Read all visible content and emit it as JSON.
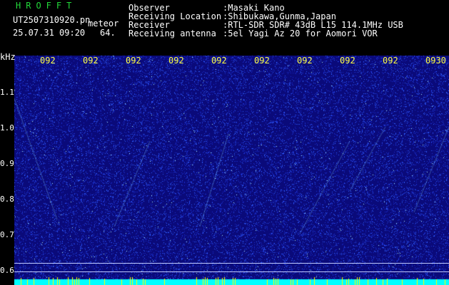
{
  "header": {
    "brand": "HROFFT",
    "filename": "UT2507310920.pn",
    "mode": "meteor",
    "datetime": "25.07.31 09:20",
    "count": "64.",
    "info": [
      {
        "label": "Observer",
        "value": ":Masaki Kano"
      },
      {
        "label": "Receiving Location",
        "value": ":Shibukawa,Gunma,Japan"
      },
      {
        "label": "Receiver",
        "value": ":RTL-SDR SDR# 43dB L15 114.1MHz USB"
      },
      {
        "label": "Receiving antenna",
        "value": ":5el Yagi Az 20 for Aomori VOR"
      }
    ]
  },
  "spectrogram": {
    "y_unit": "kHz",
    "y_ticks": [
      "1.1",
      "1.0",
      "0.9",
      "0.8",
      "0.7",
      "0.6"
    ],
    "time_ticks": [
      "092",
      "092",
      "092",
      "092",
      "092",
      "092",
      "092",
      "092",
      "092",
      "0930"
    ],
    "colors": {
      "background": "#0a0a7a",
      "noise": "#2f5cff",
      "signal": "#aef5ff",
      "bottom_band": "#00ffff",
      "tick_text": "#ffff44"
    }
  }
}
